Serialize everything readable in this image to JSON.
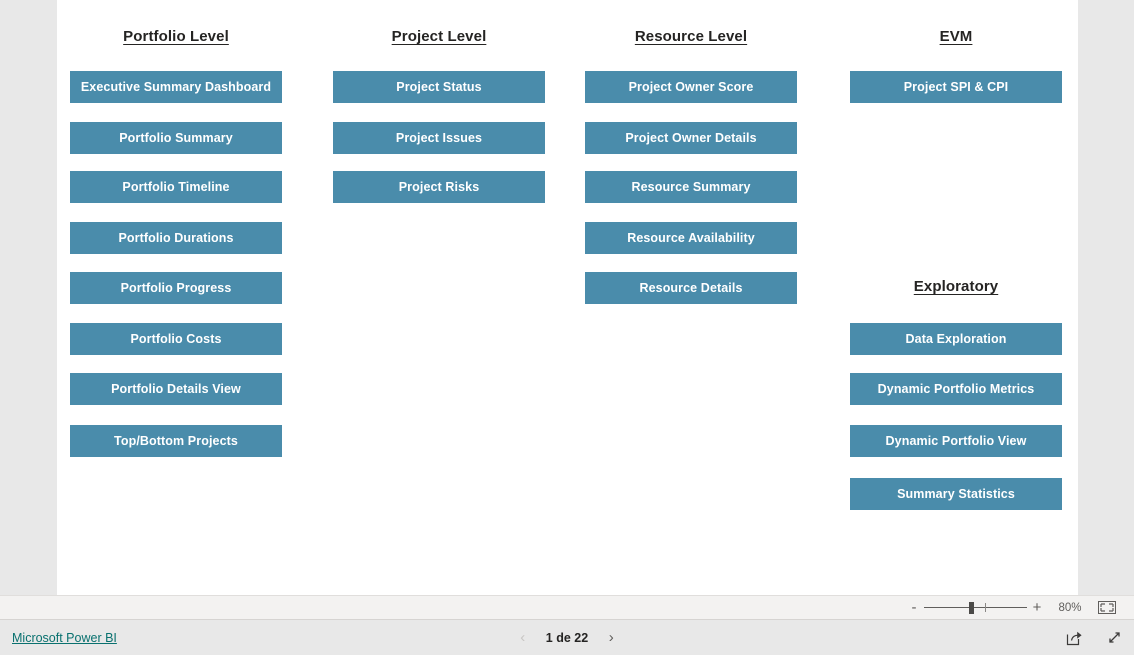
{
  "theme": {
    "button_color": "#4A8CAB",
    "canvas_bg": "#ffffff",
    "shell_bg": "#e8e8e8",
    "link_color": "#09716f",
    "heading_color": "#252423"
  },
  "report": {
    "columns": [
      {
        "id": "portfolio-level",
        "heading": "Portfolio Level",
        "buttons": [
          "Executive Summary Dashboard",
          "Portfolio Summary",
          "Portfolio Timeline",
          "Portfolio Durations",
          "Portfolio Progress",
          "Portfolio Costs",
          "Portfolio Details View",
          "Top/Bottom Projects"
        ]
      },
      {
        "id": "project-level",
        "heading": "Project Level",
        "buttons": [
          "Project Status",
          "Project Issues",
          "Project Risks"
        ]
      },
      {
        "id": "resource-level",
        "heading": "Resource Level",
        "buttons": [
          "Project Owner Score",
          "Project Owner Details",
          "Resource Summary",
          "Resource Availability",
          "Resource Details"
        ]
      },
      {
        "id": "evm",
        "heading": "EVM",
        "buttons": [
          "Project SPI & CPI"
        ]
      },
      {
        "id": "exploratory",
        "heading": "Exploratory",
        "buttons": [
          "Data Exploration",
          "Dynamic Portfolio Metrics",
          "Dynamic Portfolio View",
          "Summary Statistics"
        ]
      }
    ]
  },
  "zoom_bar": {
    "minus_label": "-",
    "plus_label": "+",
    "percent_label": "80%",
    "fit_icon": "fit-to-page-icon"
  },
  "footer": {
    "brand_label": "Microsoft Power BI",
    "prev_arrow": "‹",
    "next_arrow": "›",
    "page_label": "1 de 22",
    "share_icon": "share-icon",
    "fullscreen_icon": "fullscreen-icon"
  }
}
